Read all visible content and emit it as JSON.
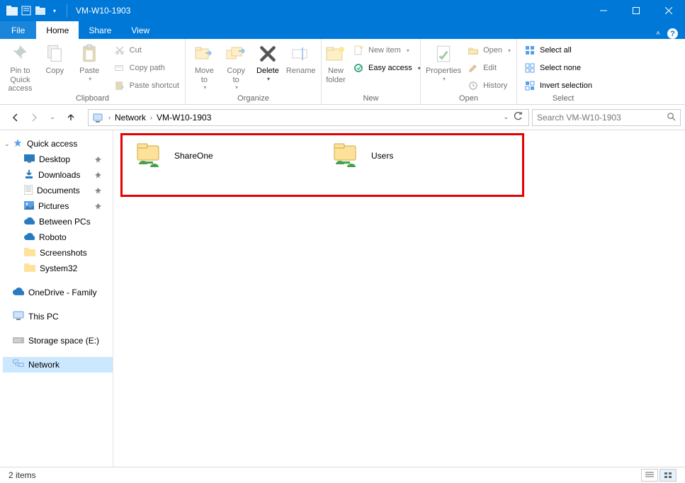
{
  "title": "VM-W10-1903",
  "tabs": {
    "file": "File",
    "home": "Home",
    "share": "Share",
    "view": "View"
  },
  "ribbon": {
    "clipboard": {
      "label": "Clipboard",
      "pin": "Pin to Quick\naccess",
      "copy": "Copy",
      "paste": "Paste",
      "cut": "Cut",
      "copypath": "Copy path",
      "pasteshortcut": "Paste shortcut"
    },
    "organize": {
      "label": "Organize",
      "moveto": "Move\nto",
      "copyto": "Copy\nto",
      "delete": "Delete",
      "rename": "Rename"
    },
    "new": {
      "label": "New",
      "newfolder": "New\nfolder",
      "newitem": "New item",
      "easyaccess": "Easy access"
    },
    "open": {
      "label": "Open",
      "properties": "Properties",
      "open": "Open",
      "edit": "Edit",
      "history": "History"
    },
    "select": {
      "label": "Select",
      "selectall": "Select all",
      "selectnone": "Select none",
      "invert": "Invert selection"
    }
  },
  "breadcrumb": {
    "network": "Network",
    "host": "VM-W10-1903"
  },
  "search_placeholder": "Search VM-W10-1903",
  "nav": {
    "quickaccess": "Quick access",
    "desktop": "Desktop",
    "downloads": "Downloads",
    "documents": "Documents",
    "pictures": "Pictures",
    "betweenpcs": "Between PCs",
    "roboto": "Roboto",
    "screenshots": "Screenshots",
    "system32": "System32",
    "onedrive": "OneDrive - Family",
    "thispc": "This PC",
    "storage": "Storage space (E:)",
    "network": "Network"
  },
  "items": {
    "shareone": "ShareOne",
    "users": "Users"
  },
  "status": "2 items"
}
